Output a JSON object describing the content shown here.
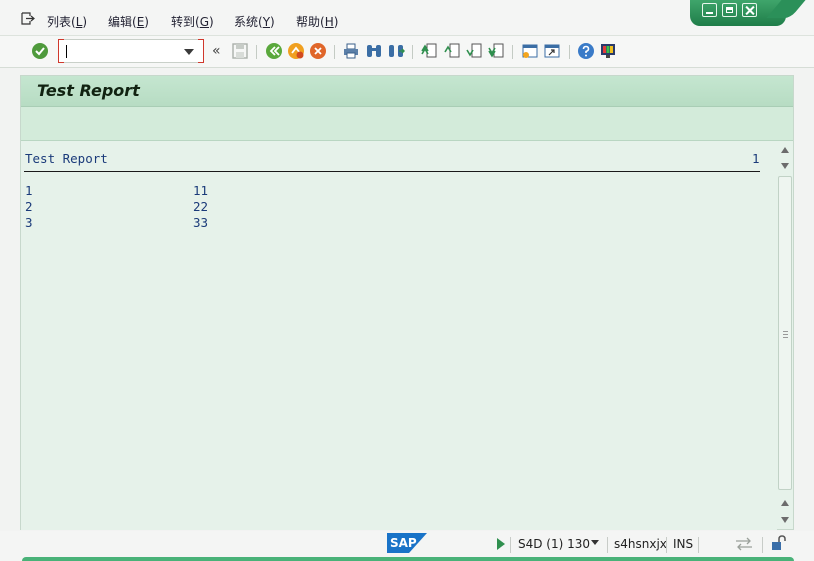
{
  "menu": {
    "items": [
      {
        "label": "列表",
        "key": "L"
      },
      {
        "label": "编辑",
        "key": "E"
      },
      {
        "label": "转到",
        "key": "G"
      },
      {
        "label": "系统",
        "key": "Y"
      },
      {
        "label": "帮助",
        "key": "H"
      }
    ]
  },
  "toolbar": {
    "command_value": "",
    "collapse_glyph": "«",
    "icons": [
      "enter-icon",
      "save-icon",
      "back-icon",
      "exit-icon",
      "cancel-icon",
      "print-icon",
      "find-icon",
      "find-next-icon",
      "first-page-icon",
      "previous-page-icon",
      "next-page-icon",
      "last-page-icon",
      "create-session-icon",
      "shortcut-icon",
      "help-icon",
      "layout-menu-icon"
    ]
  },
  "report": {
    "title": "Test Report",
    "list_header": "Test Report",
    "page_number": "1",
    "rows": [
      {
        "a": "1",
        "b": "11"
      },
      {
        "a": "2",
        "b": "22"
      },
      {
        "a": "3",
        "b": "33"
      }
    ]
  },
  "status": {
    "logo": "SAP",
    "system": "S4D (1) 130",
    "host": "s4hsnxjx",
    "mode": "INS"
  },
  "colors": {
    "title_band": "#b7dcc3",
    "list_bg": "#e6f2ea",
    "list_text": "#1b3b7a",
    "window_controls": "#1f7d49"
  }
}
